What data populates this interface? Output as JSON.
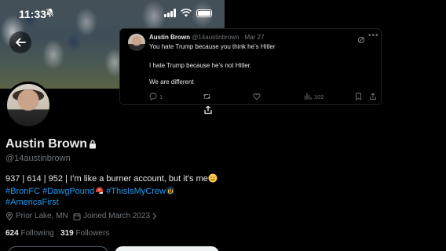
{
  "status_bar": {
    "time": "11:33"
  },
  "tweet": {
    "author_name": "Austin Brown",
    "author_handle": "@14austinbrown",
    "date_sep": "·",
    "date": "Mar 27",
    "lines": [
      "You hate Trump because you think he’s Hitler",
      "I hate Trump because he’s not Hitler.",
      "We are different"
    ],
    "replies": "1",
    "views": "102"
  },
  "profile": {
    "display_name": "Austin Brown",
    "handle": "@14austinbrown",
    "bio_line1": "937 | 614 | 952 | I’m like a burner account, but it’s me",
    "hashtags_line2a": "#BronFC #DawgPound",
    "hashtags_line2b": "#ThisIsMyCrew",
    "hashtags_line3": "#AmericaFirst",
    "location": "Prior Lake, MN",
    "joined": "Joined March 2023",
    "following_count": "624",
    "following_label": "Following",
    "followers_count": "319",
    "followers_label": "Followers"
  },
  "colors": {
    "link": "#1d9bf0",
    "muted": "#71767b",
    "text": "#e7e9ea",
    "background": "#000000"
  }
}
